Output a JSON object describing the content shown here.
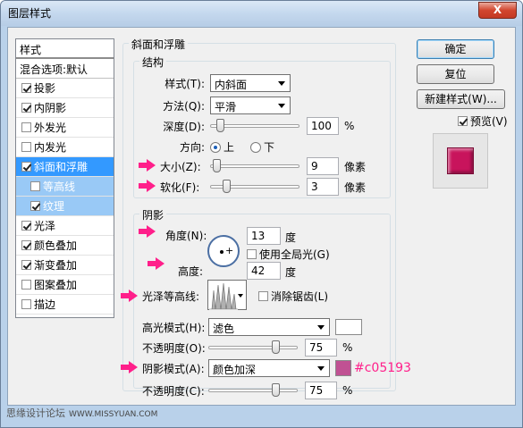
{
  "window": {
    "title": "图层样式",
    "close": "X"
  },
  "styles_list": {
    "header": "样式",
    "blend": "混合选项:默认",
    "items": [
      {
        "label": "投影",
        "checked": true
      },
      {
        "label": "内阴影",
        "checked": true
      },
      {
        "label": "外发光",
        "checked": false
      },
      {
        "label": "内发光",
        "checked": false
      },
      {
        "label": "斜面和浮雕",
        "checked": true,
        "selected": true
      },
      {
        "label": "等高线",
        "checked": false,
        "sub": true
      },
      {
        "label": "纹理",
        "checked": true,
        "sub": true
      },
      {
        "label": "光泽",
        "checked": true
      },
      {
        "label": "颜色叠加",
        "checked": true
      },
      {
        "label": "渐变叠加",
        "checked": true
      },
      {
        "label": "图案叠加",
        "checked": false
      },
      {
        "label": "描边",
        "checked": false
      }
    ]
  },
  "bevel": {
    "title": "斜面和浮雕",
    "structure": {
      "title": "结构",
      "style_label": "样式(T):",
      "style_value": "内斜面",
      "technique_label": "方法(Q):",
      "technique_value": "平滑",
      "depth_label": "深度(D):",
      "depth_value": "100",
      "depth_unit": "%",
      "depth_fraction": 0.1,
      "direction_label": "方向:",
      "direction_up": "上",
      "direction_down": "下",
      "size_label": "大小(Z):",
      "size_value": "9",
      "size_unit": "像素",
      "size_fraction": 0.06,
      "soften_label": "软化(F):",
      "soften_value": "3",
      "soften_unit": "像素",
      "soften_fraction": 0.17
    },
    "shading": {
      "title": "阴影",
      "angle_label": "角度(N):",
      "angle_value": "13",
      "angle_unit": "度",
      "global_light_label": "使用全局光(G)",
      "global_light_checked": false,
      "altitude_label": "高度:",
      "altitude_value": "42",
      "altitude_unit": "度",
      "gloss_contour_label": "光泽等高线:",
      "anti_alias_label": "消除锯齿(L)",
      "anti_alias_checked": false,
      "highlight_mode_label": "高光模式(H):",
      "highlight_mode_value": "滤色",
      "highlight_color": "#ffffff",
      "highlight_opacity_label": "不透明度(O):",
      "highlight_opacity_value": "75",
      "highlight_opacity_unit": "%",
      "highlight_opacity_fraction": 0.75,
      "shadow_mode_label": "阴影模式(A):",
      "shadow_mode_value": "颜色加深",
      "shadow_color": "#c05193",
      "shadow_color_label": "#c05193",
      "shadow_opacity_label": "不透明度(C):",
      "shadow_opacity_value": "75",
      "shadow_opacity_unit": "%",
      "shadow_opacity_fraction": 0.75
    }
  },
  "buttons": {
    "ok": "确定",
    "reset": "复位",
    "new_style": "新建样式(W)...",
    "preview_label": "预览(V)",
    "preview_checked": true
  },
  "colors": {
    "accent_pink": "#ff1f8a",
    "preview": "#c8145c"
  },
  "watermark": {
    "text": "思缘设计论坛",
    "site": "WWW.MISSYUAN.COM"
  }
}
